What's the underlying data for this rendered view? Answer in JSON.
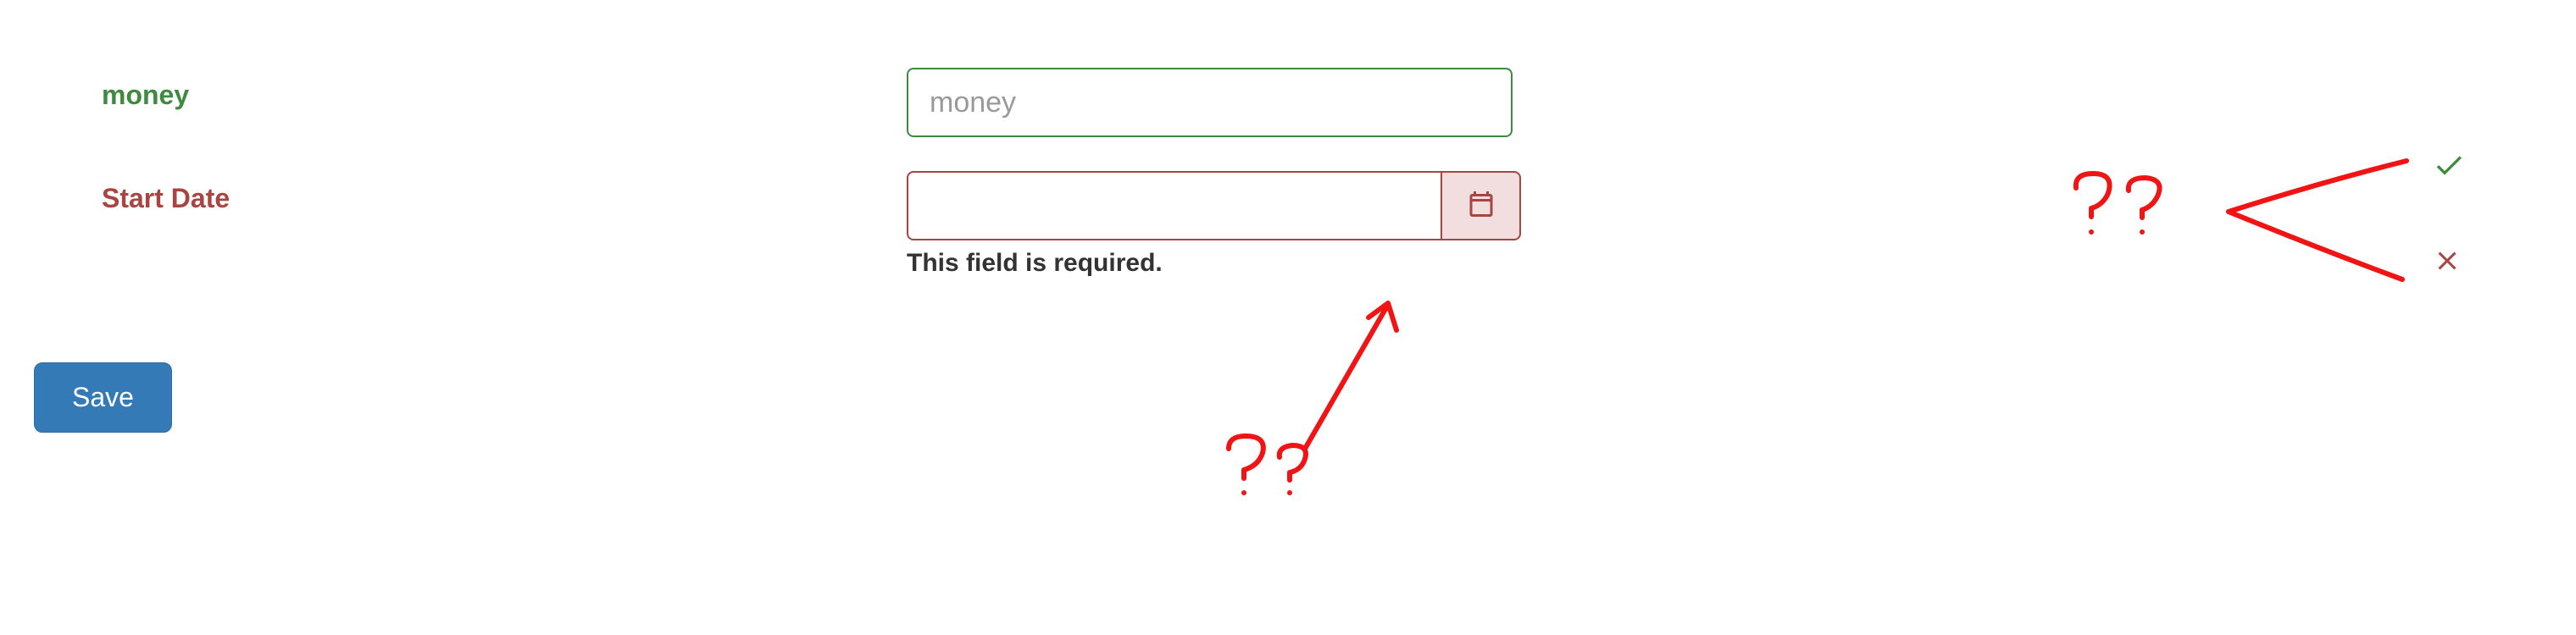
{
  "fields": {
    "money": {
      "label": "money",
      "placeholder": "money",
      "value": ""
    },
    "start_date": {
      "label": "Start Date",
      "value": "",
      "error": "This field is required."
    }
  },
  "buttons": {
    "save": "Save"
  }
}
